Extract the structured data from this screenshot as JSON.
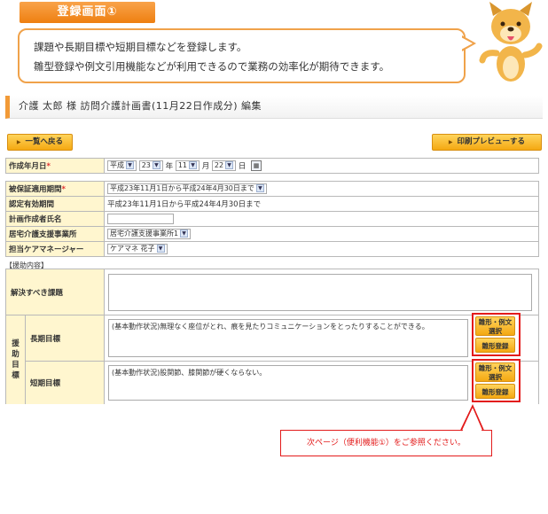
{
  "header": {
    "badge": "登録画面①",
    "bubble_line1": "課題や長期目標や短期目標などを登録します。",
    "bubble_line2": "雛型登録や例文引用機能などが利用できるので業務の効率化が期待できます。"
  },
  "page": {
    "title": "介護 太郎 様 訪問介護計画書(11月22日作成分)  編集"
  },
  "toolbar": {
    "back_label": "一覧へ戻る",
    "print_label": "印刷プレビューする"
  },
  "form": {
    "created_date": {
      "label": "作成年月日",
      "required_mark": "*",
      "era": "平成",
      "year": "23",
      "year_unit": "年",
      "month": "11",
      "month_unit": "月",
      "day": "22",
      "day_unit": "日"
    },
    "insurance_period": {
      "label": "被保証適用期間",
      "required_mark": "*",
      "value": "平成23年11月1日から平成24年4月30日まで"
    },
    "valid_period": {
      "label": "認定有効期間",
      "value": "平成23年11月1日から平成24年4月30日まで"
    },
    "author": {
      "label": "計画作成者氏名",
      "value": ""
    },
    "office": {
      "label": "居宅介護支援事業所",
      "value": "居宅介護支援事業所1"
    },
    "manager": {
      "label": "担当ケアマネージャー",
      "value": "ケアマネ 花子"
    }
  },
  "support": {
    "section_label": "【援助内容】",
    "issue_label": "解決すべき課題",
    "issue_value": "",
    "group_label": "援助目標",
    "long_label": "長期目標",
    "long_value": "(基本動作状況)無理なく座位がとれ、痕を見たりコミュニケーションをとったりすることができる。",
    "short_label": "短期目標",
    "short_value": "(基本動作状況)股関節、膝関節が硬くならない。",
    "template_select_label": "雛形・例文選択",
    "template_register_label": "雛形登録"
  },
  "callout": {
    "text": "次ページ（便利機能①）をご参照ください。"
  },
  "colors": {
    "accent": "#ee7f10",
    "label_bg": "#fff6cf",
    "highlight": "#e31b1b"
  }
}
